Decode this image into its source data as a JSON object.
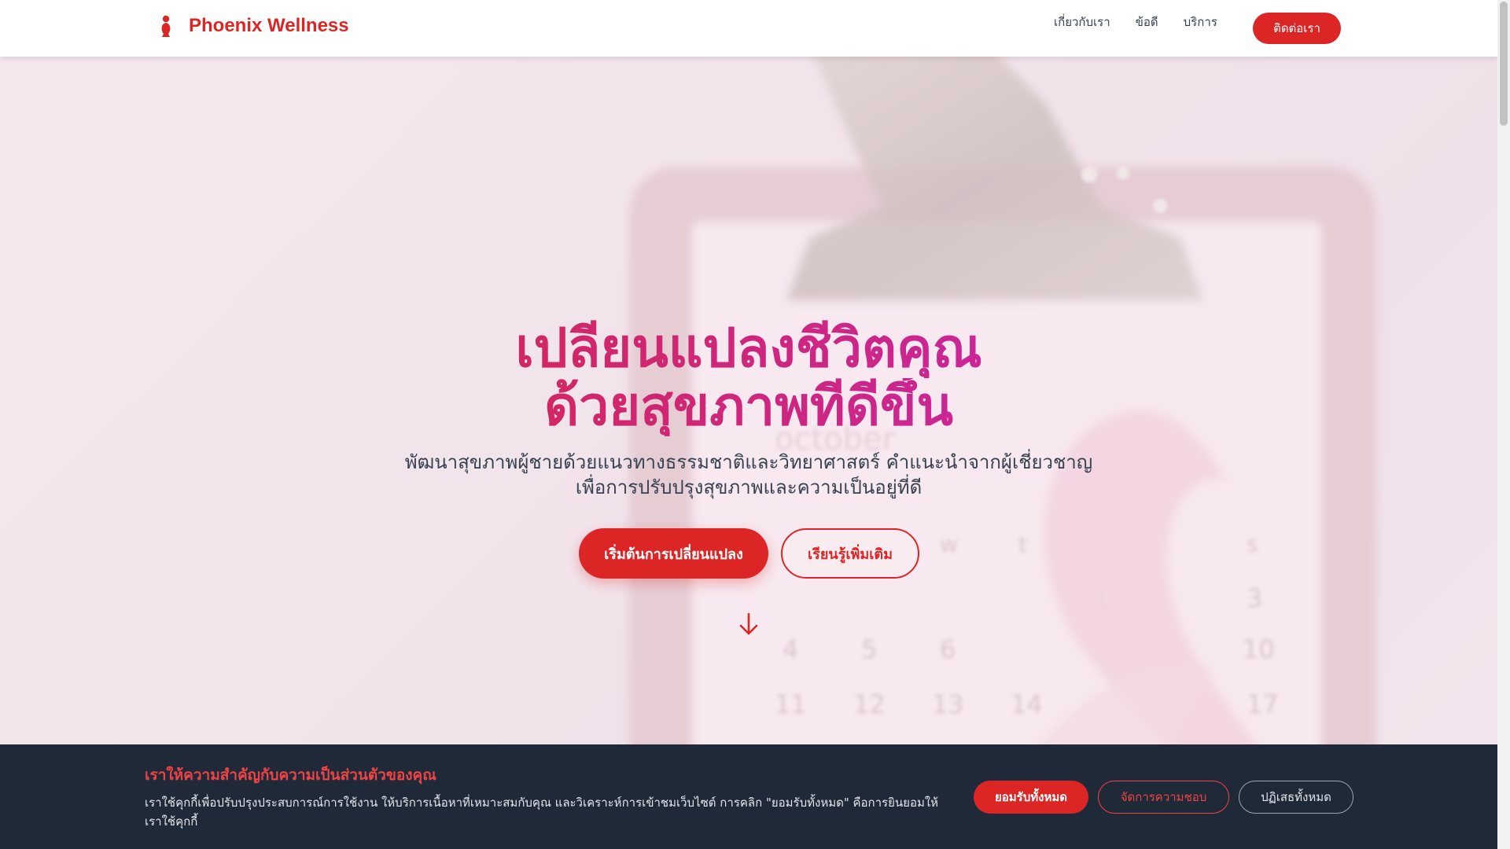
{
  "header": {
    "brand": "Phoenix Wellness",
    "nav": [
      "เกี่ยวกับเรา",
      "ข้อดี",
      "บริการ"
    ],
    "contact_label": "ติดต่อเรา"
  },
  "hero": {
    "title_line1": "เปลี่ยนแปลงชีวิตคุณ",
    "title_line2": "ด้วยสุขภาพที่ดีขึ้น",
    "subtitle_line1": "พัฒนาสุขภาพผู้ชายด้วยแนวทางธรรมชาติและวิทยาศาสตร์ คำแนะนำจากผู้เชี่ยวชาญ",
    "subtitle_line2": "เพื่อการปรับปรุงสุขภาพและความเป็นอยู่ที่ดี",
    "cta_primary": "เริ่มต้นการเปลี่ยนแปลง",
    "cta_secondary": "เรียนรู้เพิ่มเติม"
  },
  "background_calendar": {
    "month": "october",
    "weekdays": [
      "w",
      "t",
      "f",
      "s"
    ],
    "days": [
      "1",
      "3",
      "4",
      "5",
      "6",
      "10",
      "11",
      "12",
      "13",
      "14",
      "17"
    ]
  },
  "cookie": {
    "title": "เราให้ความสำคัญกับความเป็นส่วนตัวของคุณ",
    "text": "เราใช้คุกกี้เพื่อปรับปรุงประสบการณ์การใช้งาน ให้บริการเนื้อหาที่เหมาะสมกับคุณ และวิเคราะห์การเข้าชมเว็บไซต์ การคลิก \"ยอมรับทั้งหมด\" คือการยินยอมให้เราใช้คุกกี้",
    "accept_label": "ยอมรับทั้งหมด",
    "manage_label": "จัดการความชอบ",
    "reject_label": "ปฏิเสธทั้งหมด"
  },
  "colors": {
    "brand_red": "#dc2626",
    "gradient_end": "#c026d3",
    "banner_bg": "#1f2937"
  },
  "icons": {
    "logo": "flame-figure-icon",
    "scroll": "arrow-down-icon"
  }
}
